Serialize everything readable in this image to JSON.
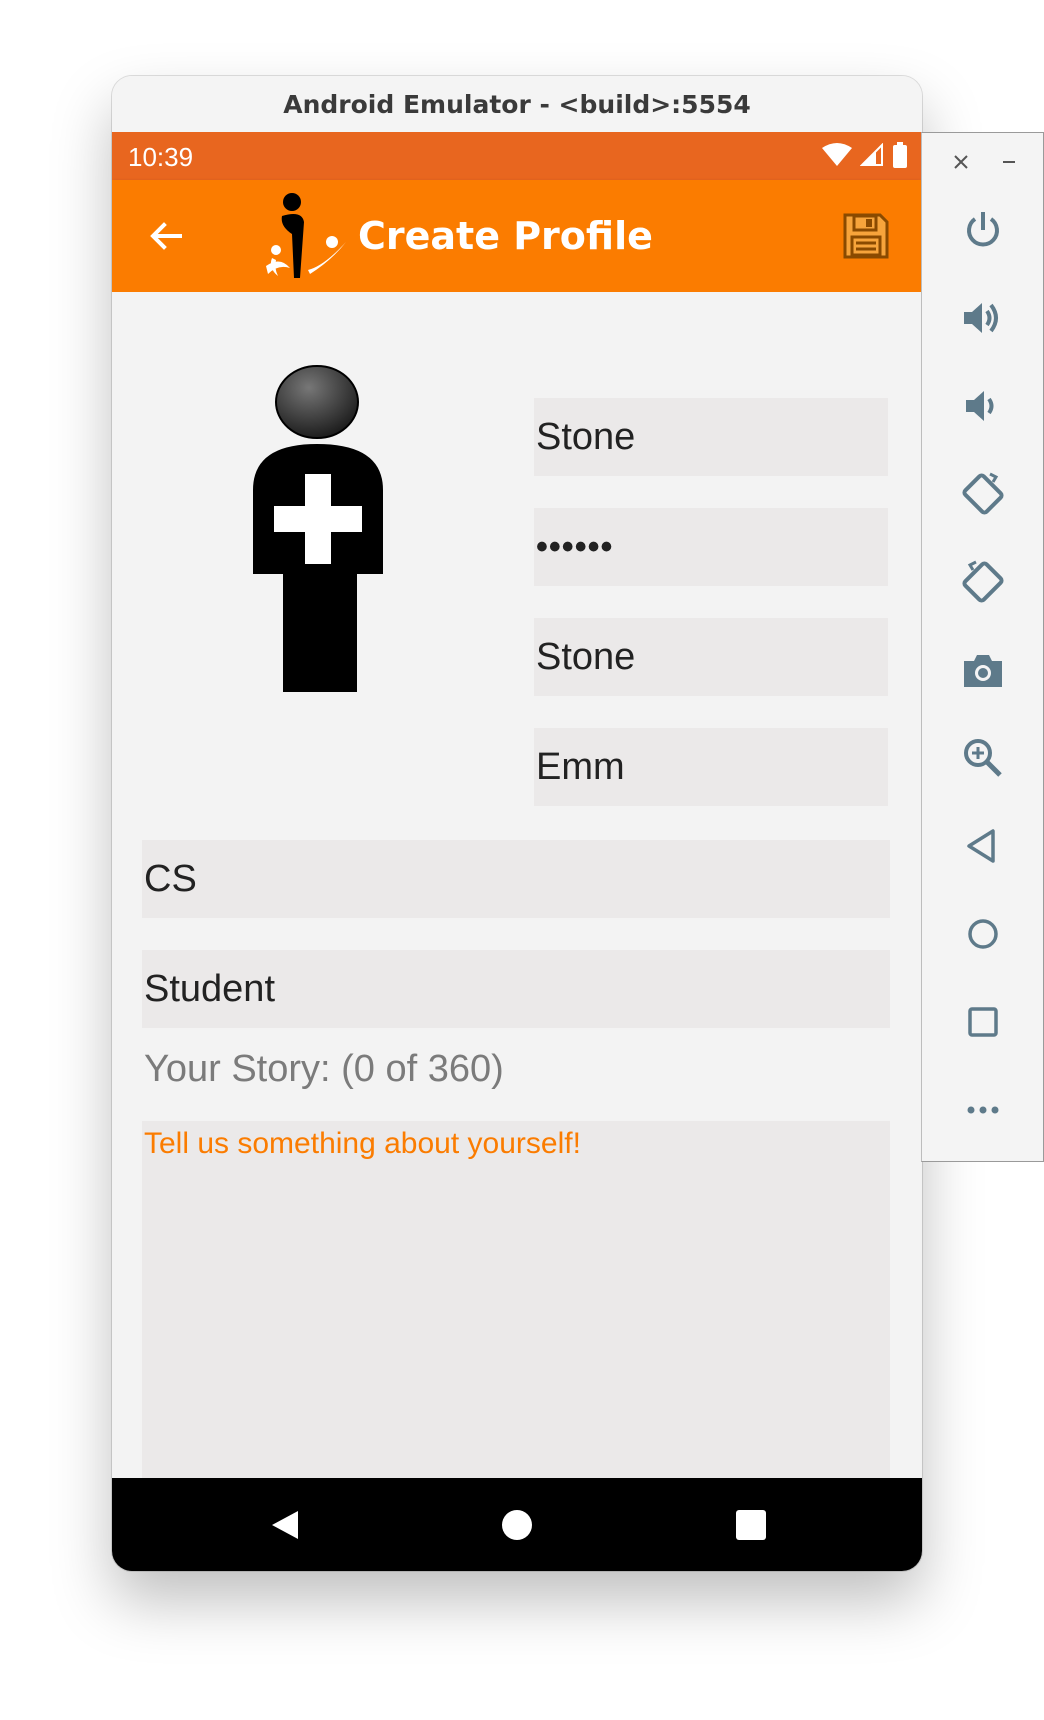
{
  "window": {
    "title": "Android Emulator - <build>:5554"
  },
  "status_bar": {
    "time": "10:39",
    "color": "#e8661f"
  },
  "app_bar": {
    "title": "Create Profile",
    "color": "#fb7c00"
  },
  "form": {
    "username": "Stone",
    "password": "••••••",
    "last_name": "Stone",
    "first_name": "Emm",
    "major": "CS",
    "role": "Student",
    "story_label": "Your Story: (0 of 360)",
    "story_placeholder": "Tell us something about yourself!"
  },
  "icons": {
    "back": "arrow-left-icon",
    "save": "floppy-disk-icon",
    "avatar": "add-person-icon",
    "side_buttons": [
      "power-icon",
      "volume-up-icon",
      "volume-down-icon",
      "rotate-left-icon",
      "rotate-right-icon",
      "camera-icon",
      "zoom-icon",
      "back-icon",
      "home-icon",
      "overview-icon",
      "more-icon"
    ]
  }
}
